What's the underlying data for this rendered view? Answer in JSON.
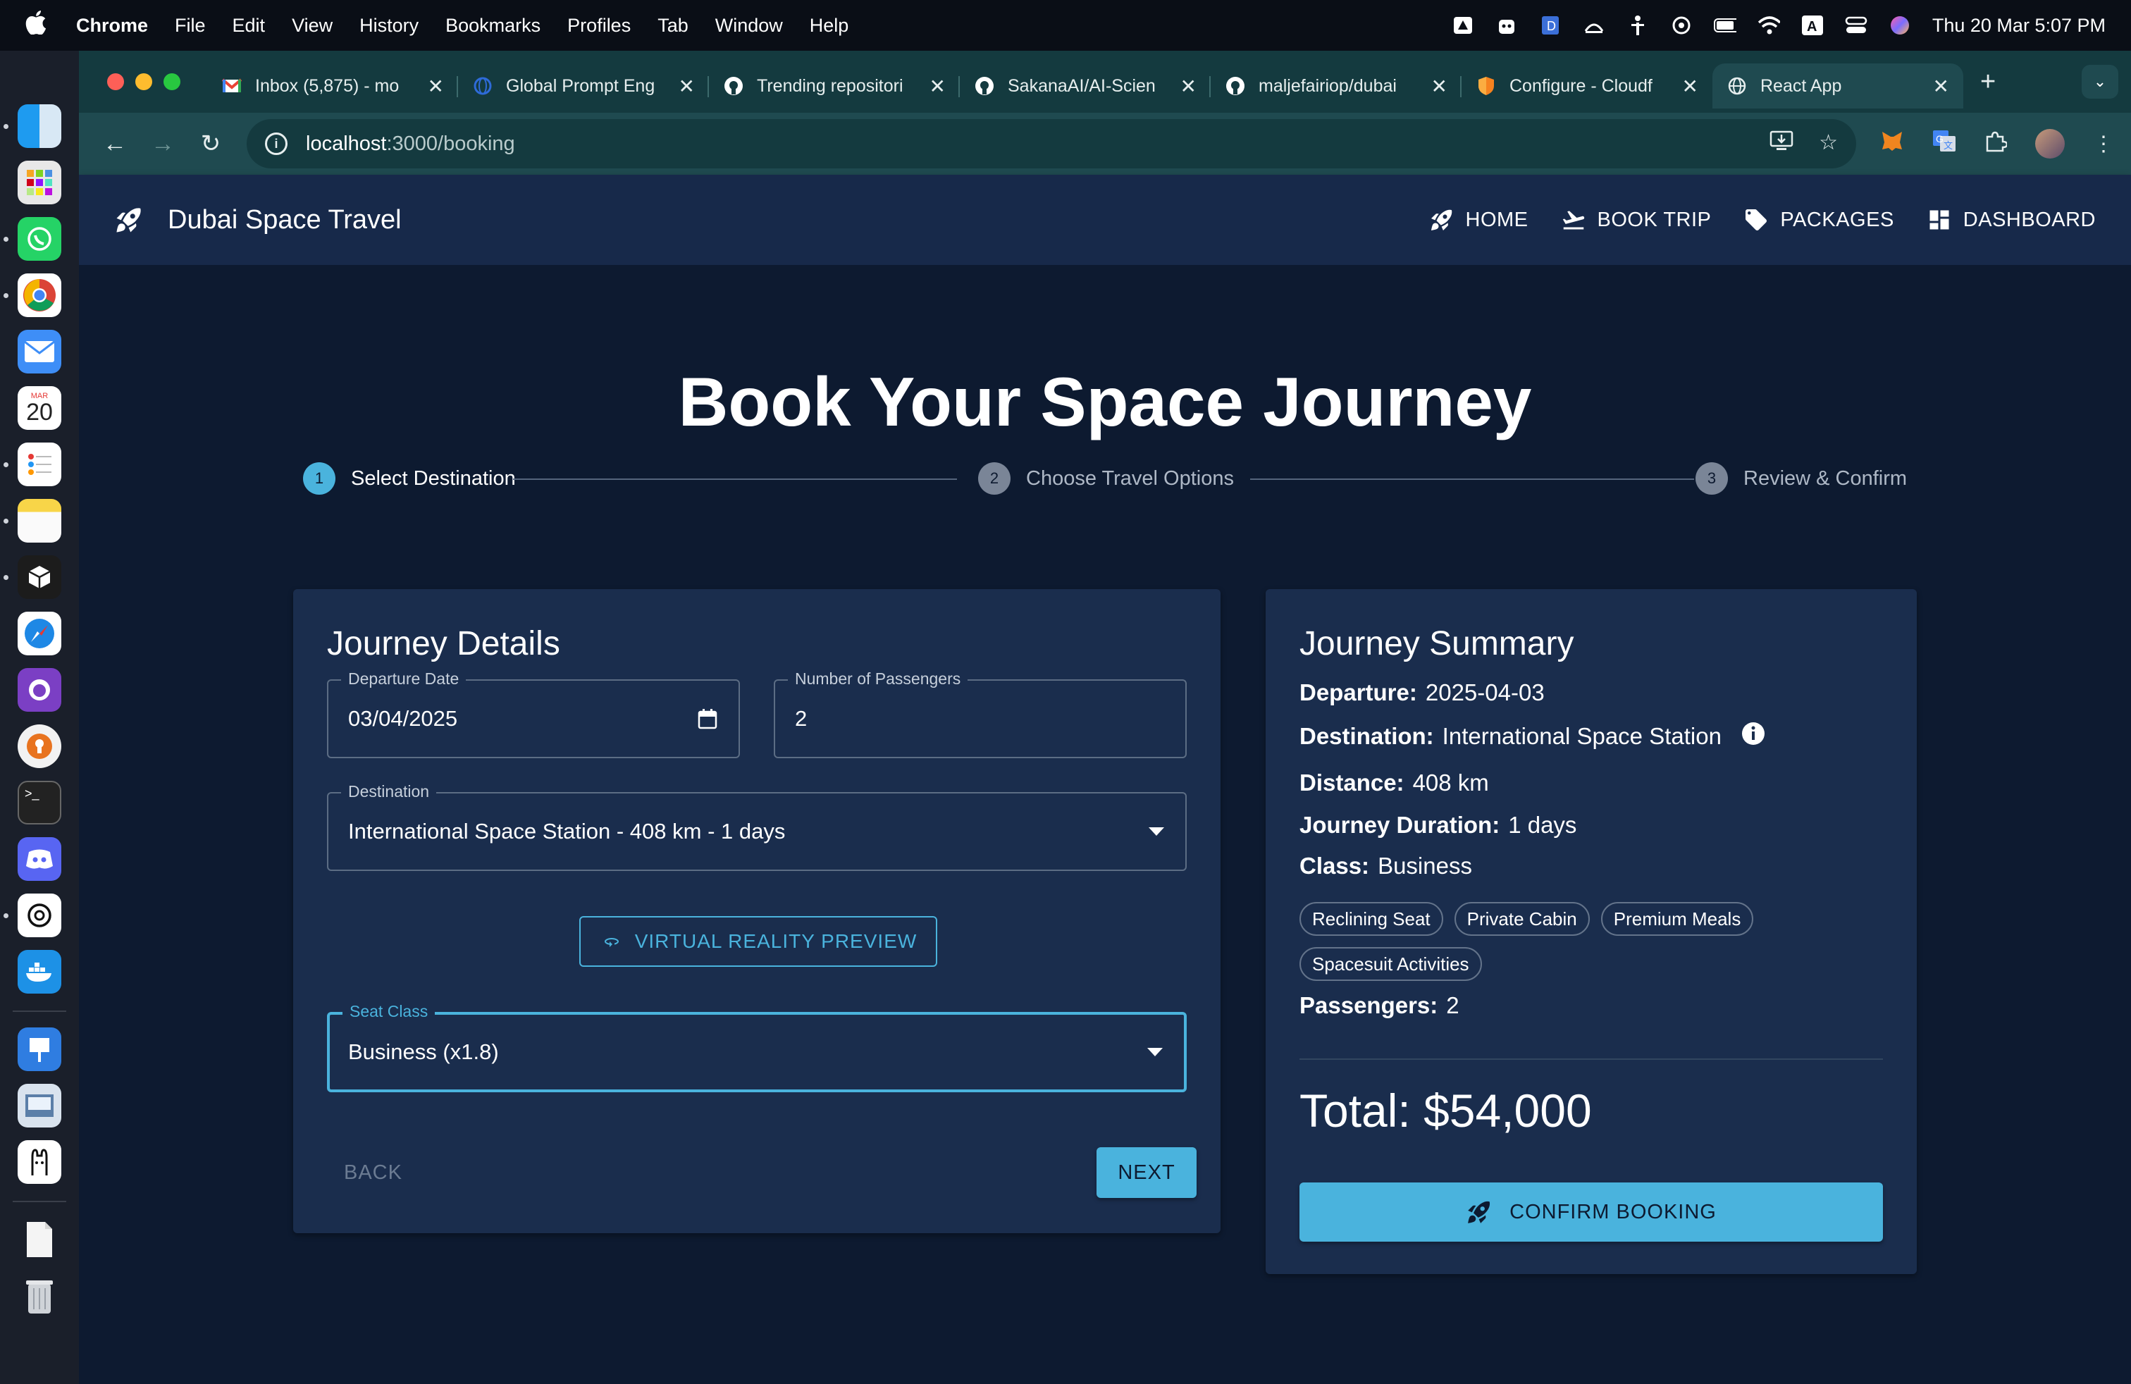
{
  "menubar": {
    "app": "Chrome",
    "items": [
      "File",
      "Edit",
      "View",
      "History",
      "Bookmarks",
      "Profiles",
      "Tab",
      "Window",
      "Help"
    ],
    "clock": "Thu 20 Mar  5:07 PM"
  },
  "browser": {
    "tabs": [
      {
        "title": "Inbox (5,875) - mo",
        "icon": "gmail-icon"
      },
      {
        "title": "Global Prompt Eng",
        "icon": "globe-icon"
      },
      {
        "title": "Trending repositori",
        "icon": "github-icon"
      },
      {
        "title": "SakanaAI/AI-Scien",
        "icon": "github-icon"
      },
      {
        "title": "maljefairiop/dubai",
        "icon": "github-icon"
      },
      {
        "title": "Configure - Cloudf",
        "icon": "shield-icon"
      },
      {
        "title": "React App",
        "icon": "globe-icon",
        "active": true
      }
    ],
    "url_host": "localhost",
    "url_path": ":3000/booking"
  },
  "app": {
    "brand": "Dubai Space Travel",
    "nav": [
      {
        "label": "HOME",
        "icon": "rocket-icon"
      },
      {
        "label": "BOOK TRIP",
        "icon": "flight-icon"
      },
      {
        "label": "PACKAGES",
        "icon": "tag-icon"
      },
      {
        "label": "DASHBOARD",
        "icon": "dashboard-icon"
      }
    ],
    "title": "Book Your Space Journey",
    "steps": [
      {
        "num": "1",
        "label": "Select Destination",
        "active": true
      },
      {
        "num": "2",
        "label": "Choose Travel Options",
        "active": false
      },
      {
        "num": "3",
        "label": "Review & Confirm",
        "active": false
      }
    ],
    "form": {
      "heading": "Journey Details",
      "departure_label": "Departure Date",
      "departure_value": "03/04/2025",
      "passengers_label": "Number of Passengers",
      "passengers_value": "2",
      "destination_label": "Destination",
      "destination_value": "International Space Station - 408 km - 1 days",
      "vr_button": "VIRTUAL REALITY PREVIEW",
      "seat_label": "Seat Class",
      "seat_value": "Business (x1.8)",
      "back": "BACK",
      "next": "NEXT"
    },
    "summary": {
      "heading": "Journey Summary",
      "departure_label": "Departure:",
      "departure_value": "2025-04-03",
      "destination_label": "Destination:",
      "destination_value": "International Space Station",
      "distance_label": "Distance:",
      "distance_value": "408 km",
      "duration_label": "Journey Duration:",
      "duration_value": "1 days",
      "class_label": "Class:",
      "class_value": "Business",
      "amenities": [
        "Reclining Seat",
        "Private Cabin",
        "Premium Meals",
        "Spacesuit Activities"
      ],
      "passengers_label": "Passengers:",
      "passengers_value": "2",
      "total": "Total: $54,000",
      "confirm": "CONFIRM BOOKING"
    }
  },
  "colors": {
    "accent": "#4ab3dd",
    "appbar": "#17294a",
    "card": "#1a2d4d",
    "page": "#0d1a30",
    "chrome_frame": "#143a3f"
  }
}
